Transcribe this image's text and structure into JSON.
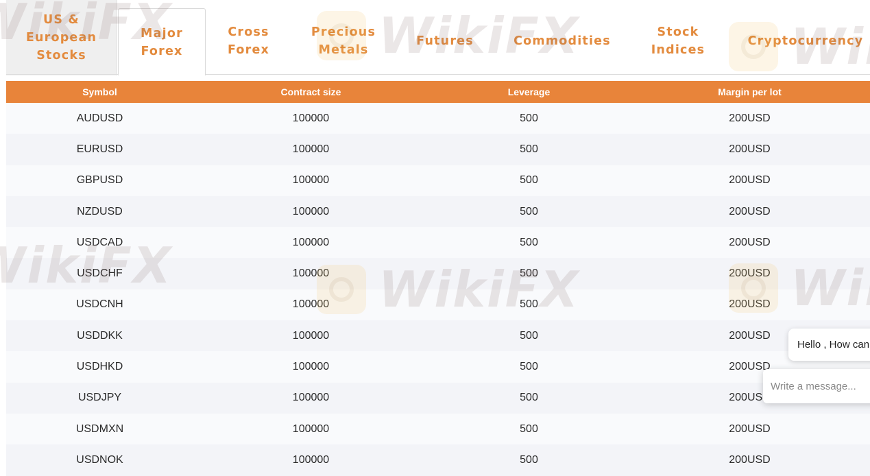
{
  "tabs": [
    {
      "label": "US &\nEuropean\nStocks"
    },
    {
      "label": "Major\nForex"
    },
    {
      "label": "Cross\nForex"
    },
    {
      "label": "Precious\nMetals"
    },
    {
      "label": "Futures"
    },
    {
      "label": "Commodities"
    },
    {
      "label": "Stock\nIndices"
    },
    {
      "label": "Cryptocurrency"
    }
  ],
  "active_tab": "Major Forex",
  "table": {
    "headers": [
      "Symbol",
      "Contract size",
      "Leverage",
      "Margin per lot"
    ],
    "rows": [
      [
        "AUDUSD",
        "100000",
        "500",
        "200USD"
      ],
      [
        "EURUSD",
        "100000",
        "500",
        "200USD"
      ],
      [
        "GBPUSD",
        "100000",
        "500",
        "200USD"
      ],
      [
        "NZDUSD",
        "100000",
        "500",
        "200USD"
      ],
      [
        "USDCAD",
        "100000",
        "500",
        "200USD"
      ],
      [
        "USDCHF",
        "100000",
        "500",
        "200USD"
      ],
      [
        "USDCNH",
        "100000",
        "500",
        "200USD"
      ],
      [
        "USDDKK",
        "100000",
        "500",
        "200USD"
      ],
      [
        "USDHKD",
        "100000",
        "500",
        "200USD"
      ],
      [
        "USDJPY",
        "100000",
        "500",
        "200USD"
      ],
      [
        "USDMXN",
        "100000",
        "500",
        "200USD"
      ],
      [
        "USDNOK",
        "100000",
        "500",
        "200USD"
      ]
    ]
  },
  "watermark": {
    "text": "WikiFX"
  },
  "chat": {
    "greeting": "Hello , How can",
    "input_placeholder": "Write a message..."
  },
  "colors": {
    "accent": "#e8843a",
    "tab_text": "#e38b3e"
  }
}
